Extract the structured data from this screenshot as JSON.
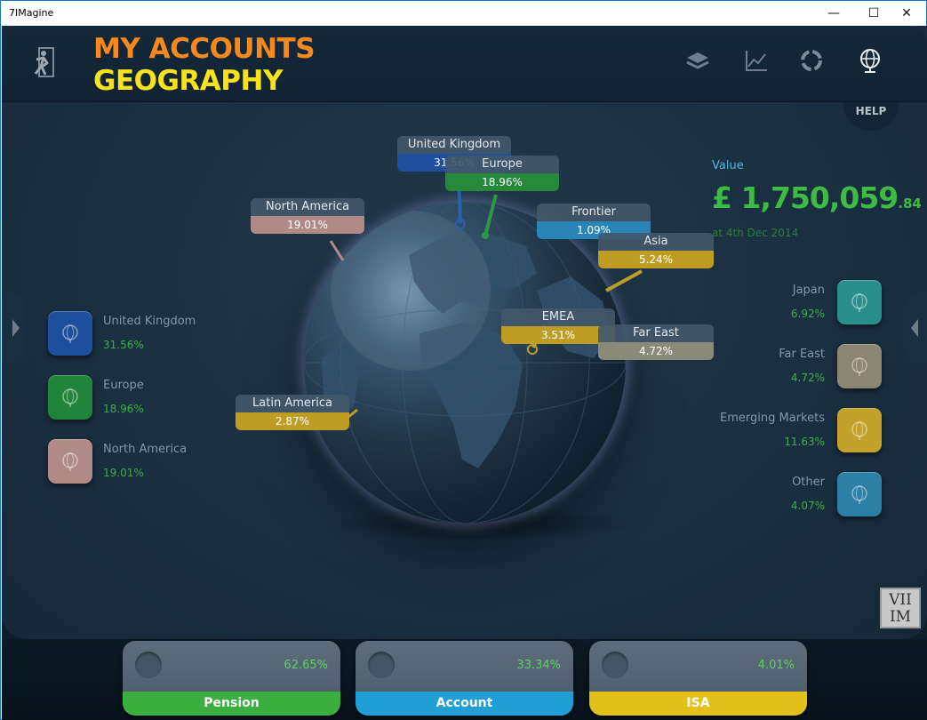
{
  "window": {
    "title": "7IMagine",
    "minimize": "—",
    "maximize": "☐",
    "close": "✕"
  },
  "header": {
    "title_line1": "MY ACCOUNTS",
    "title_line2": "GEOGRAPHY",
    "icons": [
      "exit-icon",
      "stack-icon",
      "chart-icon",
      "refresh-icon",
      "globe-icon"
    ],
    "help_label": "HELP"
  },
  "value": {
    "label": "Value",
    "main": "£ 1,750,059",
    "decimals": ".84",
    "date": "at 4th Dec 2014"
  },
  "globe_tags": [
    {
      "name": "United Kingdom",
      "pct": "31.56%",
      "color": "#1f4f9e"
    },
    {
      "name": "Europe",
      "pct": "18.96%",
      "color": "#25883a"
    },
    {
      "name": "North America",
      "pct": "19.01%",
      "color": "#b08a86"
    },
    {
      "name": "Frontier",
      "pct": "1.09%",
      "color": "#2a84b8"
    },
    {
      "name": "Asia",
      "pct": "5.24%",
      "color": "#bf9d25"
    },
    {
      "name": "EMEA",
      "pct": "3.51%",
      "color": "#bf9d25"
    },
    {
      "name": "Far East",
      "pct": "4.72%",
      "color": "#8a8a78"
    },
    {
      "name": "Latin America",
      "pct": "2.87%",
      "color": "#bf9d25"
    }
  ],
  "left_regions": [
    {
      "name": "United Kingdom",
      "pct": "31.56%",
      "color": "#1e4f9c"
    },
    {
      "name": "Europe",
      "pct": "18.96%",
      "color": "#22843a"
    },
    {
      "name": "North America",
      "pct": "19.01%",
      "color": "#b08a86"
    }
  ],
  "right_regions": [
    {
      "name": "Japan",
      "pct": "6.92%",
      "color": "#2a8e8c"
    },
    {
      "name": "Far East",
      "pct": "4.72%",
      "color": "#8d8574"
    },
    {
      "name": "Emerging Markets",
      "pct": "11.63%",
      "color": "#c4a12a"
    },
    {
      "name": "Other",
      "pct": "4.07%",
      "color": "#2c7fa6"
    }
  ],
  "accounts": [
    {
      "name": "Pension",
      "pct": "62.65%",
      "color": "#3aae3f"
    },
    {
      "name": "Account",
      "pct": "33.34%",
      "color": "#1f9fd6"
    },
    {
      "name": "ISA",
      "pct": "4.01%",
      "color": "#e2c21a"
    }
  ],
  "logo_text": [
    "VII",
    "IM"
  ]
}
